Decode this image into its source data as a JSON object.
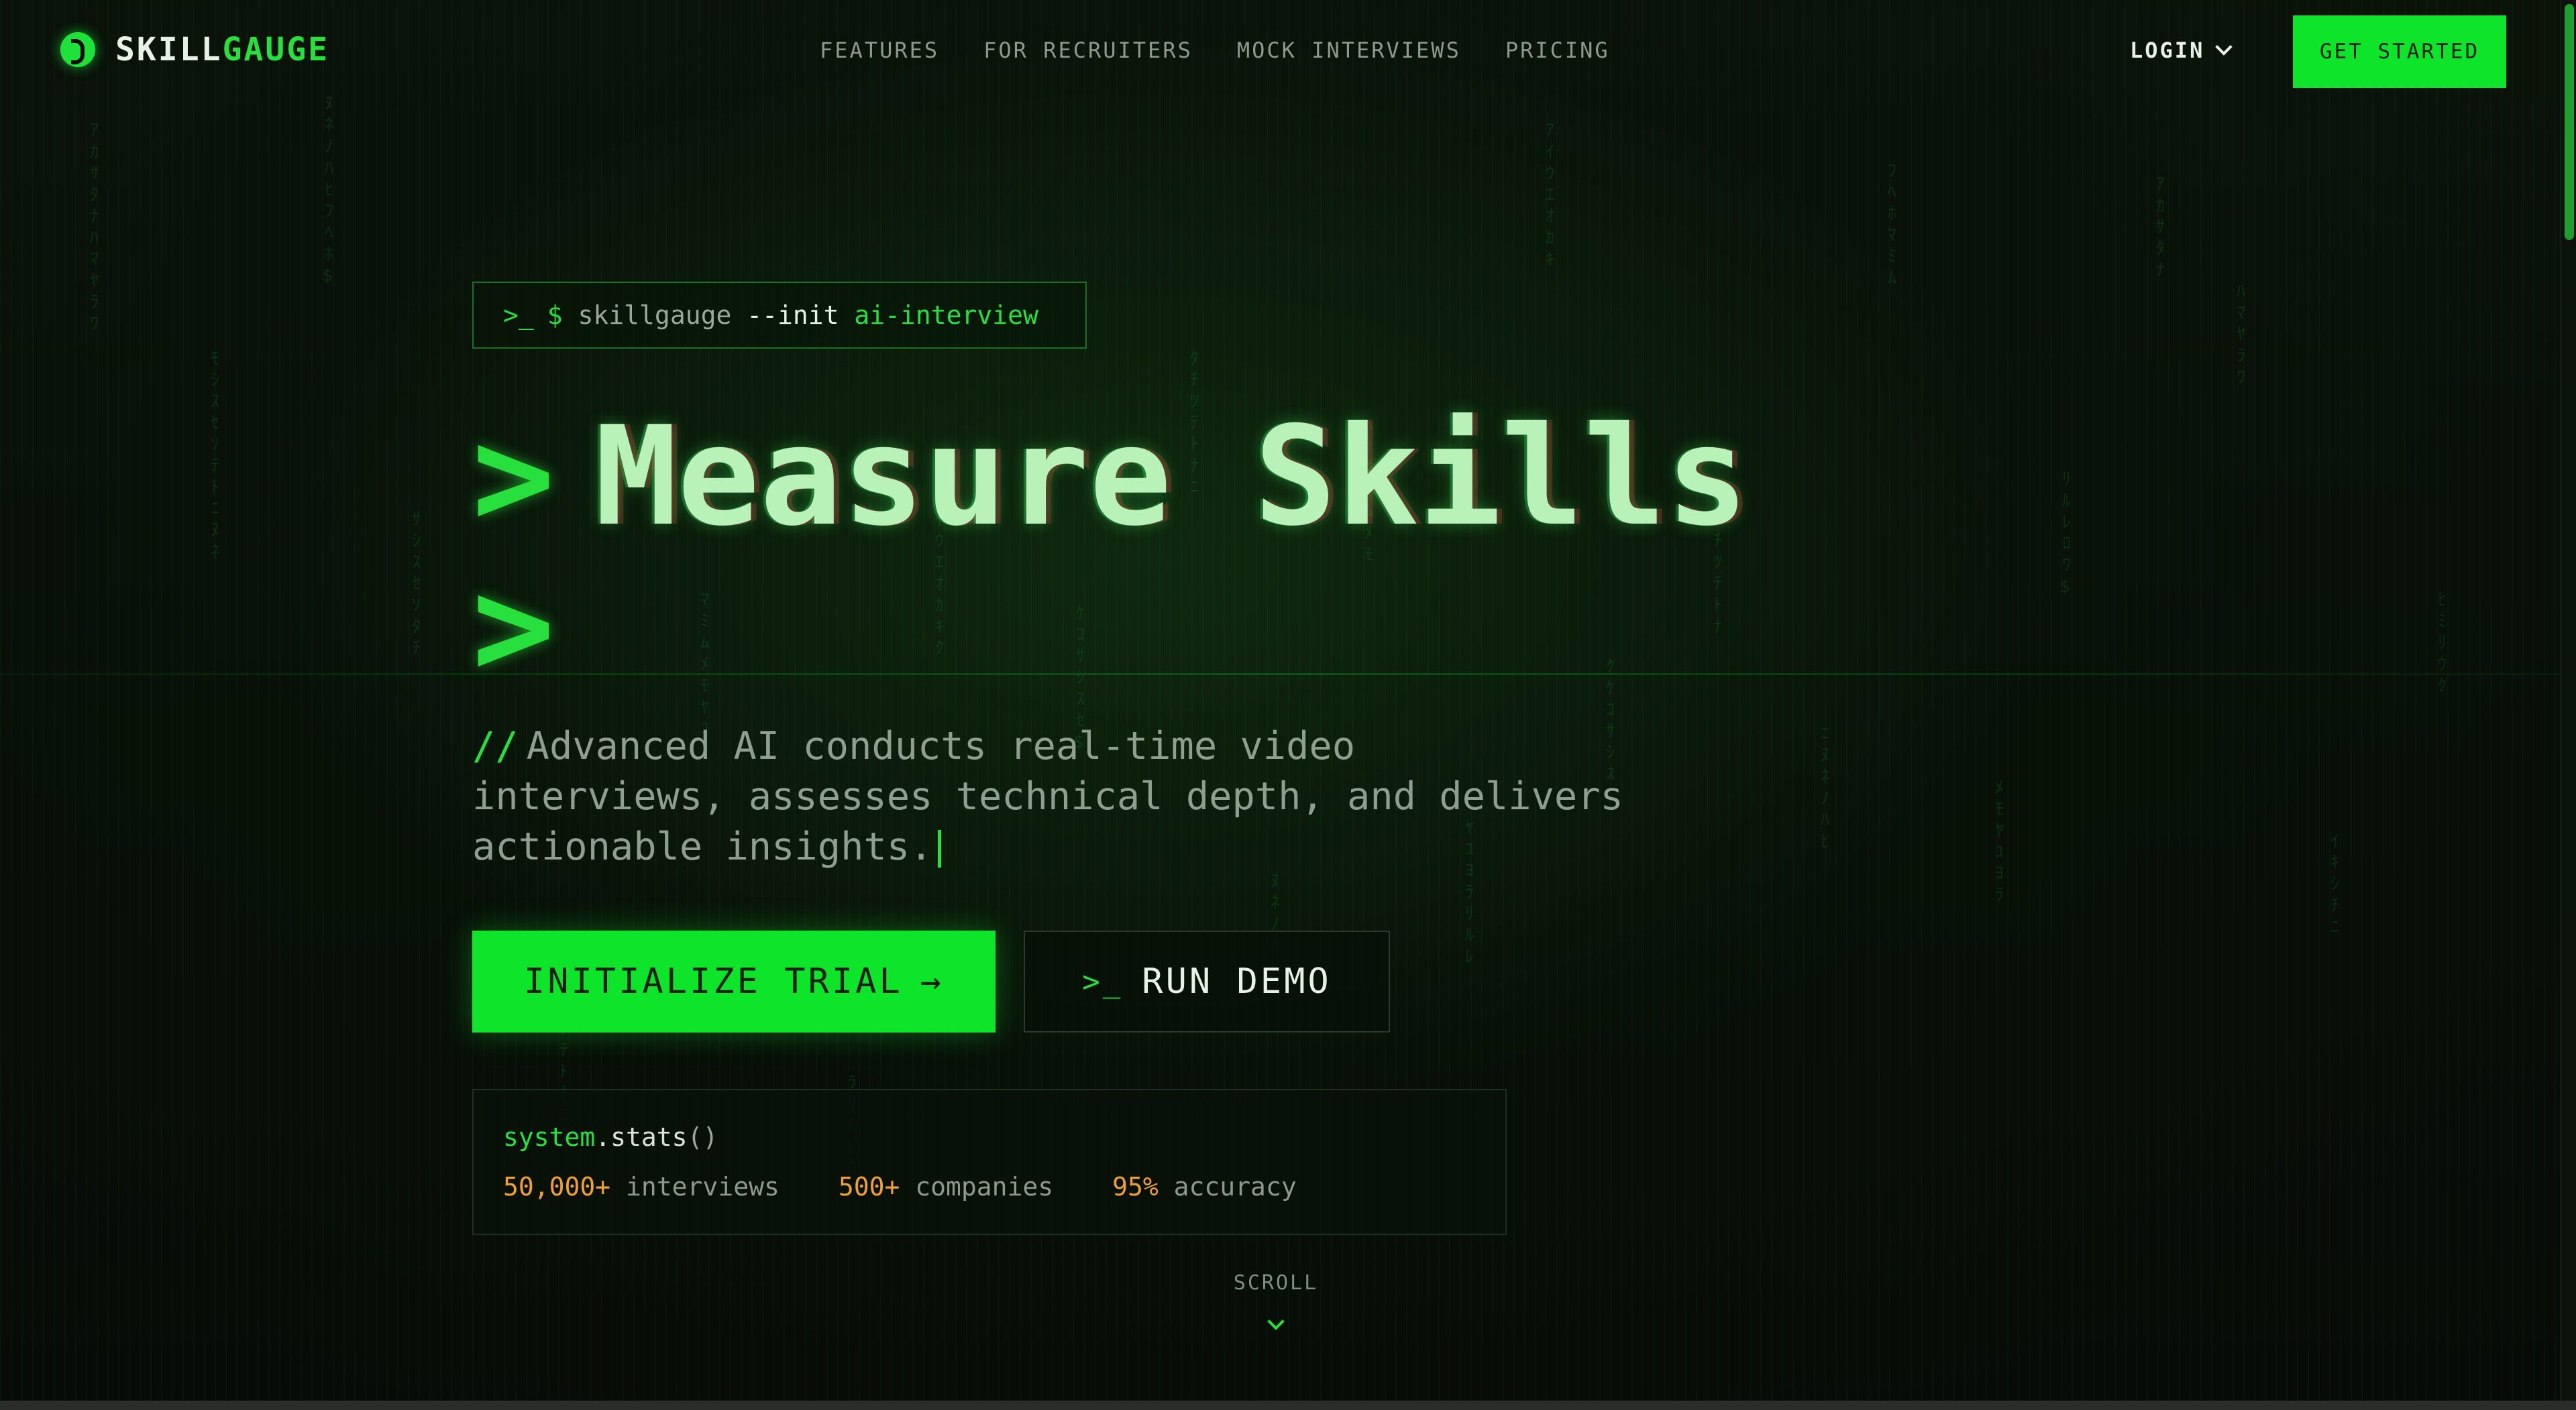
{
  "nav": {
    "brand_main": "SKILL",
    "brand_accent": "GAUGE",
    "links": [
      "FEATURES",
      "FOR RECRUITERS",
      "MOCK INTERVIEWS",
      "PRICING"
    ],
    "login_label": "LOGIN",
    "cta_label": "GET STARTED"
  },
  "hero": {
    "command": {
      "prompt_icon": ">_",
      "dollar": "$",
      "program": "skillgauge",
      "flag": "--init",
      "argument": "ai-interview"
    },
    "headline_prompt": ">",
    "headline_line1": "Measure Skills",
    "headline_line2_prompt": ">",
    "subtitle_prefix": "//",
    "subtitle": "Advanced AI conducts real-time video interviews, assesses technical depth, and delivers actionable insights.",
    "primary_button": "INITIALIZE TRIAL",
    "primary_arrow": "→",
    "secondary_icon": ">_",
    "secondary_button": "RUN DEMO"
  },
  "stats": {
    "object": "system",
    "dot": ".",
    "method": "stats",
    "parens": "()",
    "items": [
      {
        "value": "50,000+",
        "label": "interviews"
      },
      {
        "value": "500+",
        "label": "companies"
      },
      {
        "value": "95%",
        "label": "accuracy"
      }
    ]
  },
  "scroll_label": "SCROLL",
  "colors": {
    "accent": "#0ee52a",
    "background": "#060a06",
    "stat_number": "#f0a030"
  },
  "icons": [
    "logo-icon",
    "chevron-down-icon",
    "terminal-icon",
    "arrow-right-icon"
  ]
}
